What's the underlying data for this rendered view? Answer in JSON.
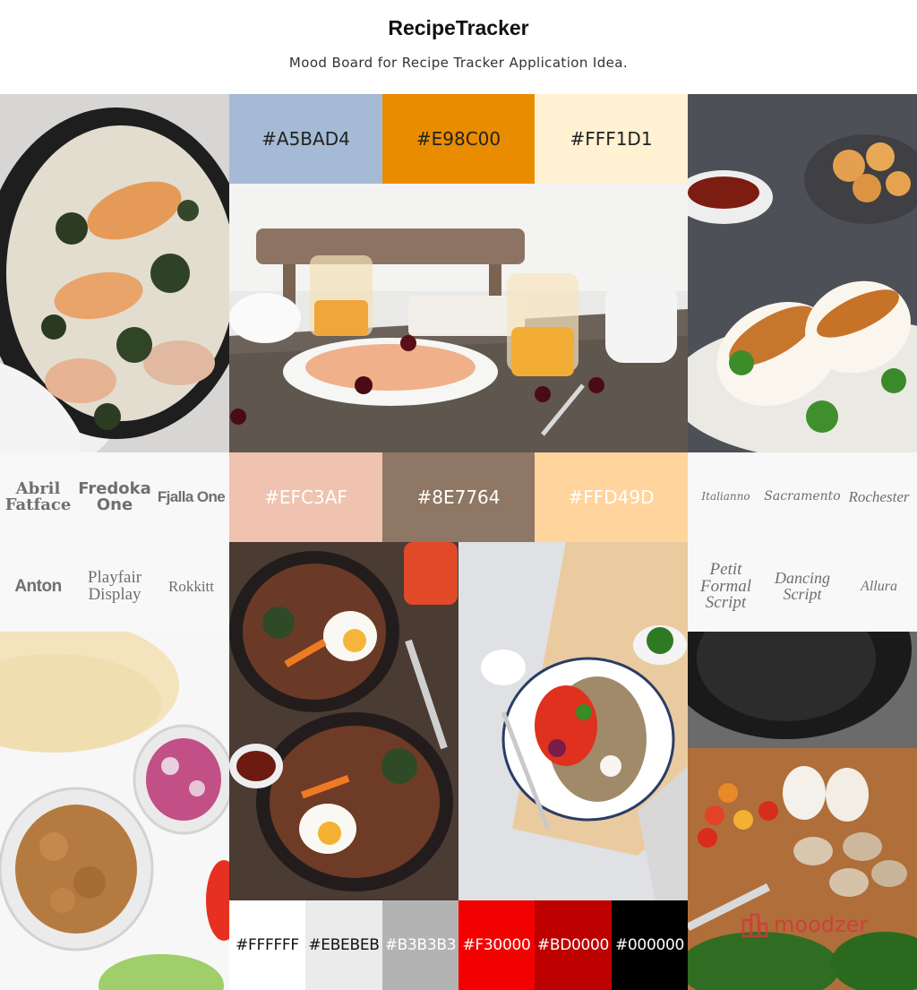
{
  "header": {
    "title": "RecipeTracker",
    "subtitle": "Mood Board for Recipe Tracker Application Idea."
  },
  "palette_top": [
    {
      "label": "#A5BAD4",
      "color": "#A5BAD4",
      "text_color": "#222222"
    },
    {
      "label": "#E98C00",
      "color": "#E98C00",
      "text_color": "#222222"
    },
    {
      "label": "#FFF1D1",
      "color": "#FFF1D1",
      "text_color": "#222222"
    }
  ],
  "palette_middle": [
    {
      "label": "#EFC3AF",
      "color": "#EFC3AF",
      "text_color": "#FFFFFF"
    },
    {
      "label": "#8E7764",
      "color": "#8E7764",
      "text_color": "#FFFFFF"
    },
    {
      "label": "#FFD49D",
      "color": "#FFD49D",
      "text_color": "#FFFFFF"
    }
  ],
  "palette_bottom": [
    {
      "label": "#FFFFFF",
      "color": "#FFFFFF",
      "text_color": "#111111"
    },
    {
      "label": "#EBEBEB",
      "color": "#EBEBEB",
      "text_color": "#111111"
    },
    {
      "label": "#B3B3B3",
      "color": "#B3B3B3",
      "text_color": "#FFFFFF"
    },
    {
      "label": "#F30000",
      "color": "#F30000",
      "text_color": "#FFFFFF"
    },
    {
      "label": "#BD0000",
      "color": "#BD0000",
      "text_color": "#FFFFFF"
    },
    {
      "label": "#000000",
      "color": "#000000",
      "text_color": "#FFFFFF"
    }
  ],
  "fonts_left": [
    "Abril Fatface",
    "Fredoka One",
    "Fjalla One",
    "Anton",
    "Playfair Display",
    "Rokkitt"
  ],
  "fonts_right": [
    "Italianno",
    "Sacramento",
    "Rochester",
    "Petit Formal Script",
    "Dancing Script",
    "Allura"
  ],
  "watermark": {
    "text": "moodzer",
    "icon": "moodzer-logo-icon"
  },
  "photos": {
    "salmon_skillet": "salmon-skillet-photo",
    "breakfast_table": "breakfast-table-photo",
    "bao_buns": "bao-buns-photo",
    "bibimbap_bowls": "bibimbap-bowls-photo",
    "salad_plate": "salad-plate-photo",
    "tortilla_ingredients": "tortilla-ingredients-photo",
    "cutting_board_vegetables": "cutting-board-vegetables-photo"
  }
}
